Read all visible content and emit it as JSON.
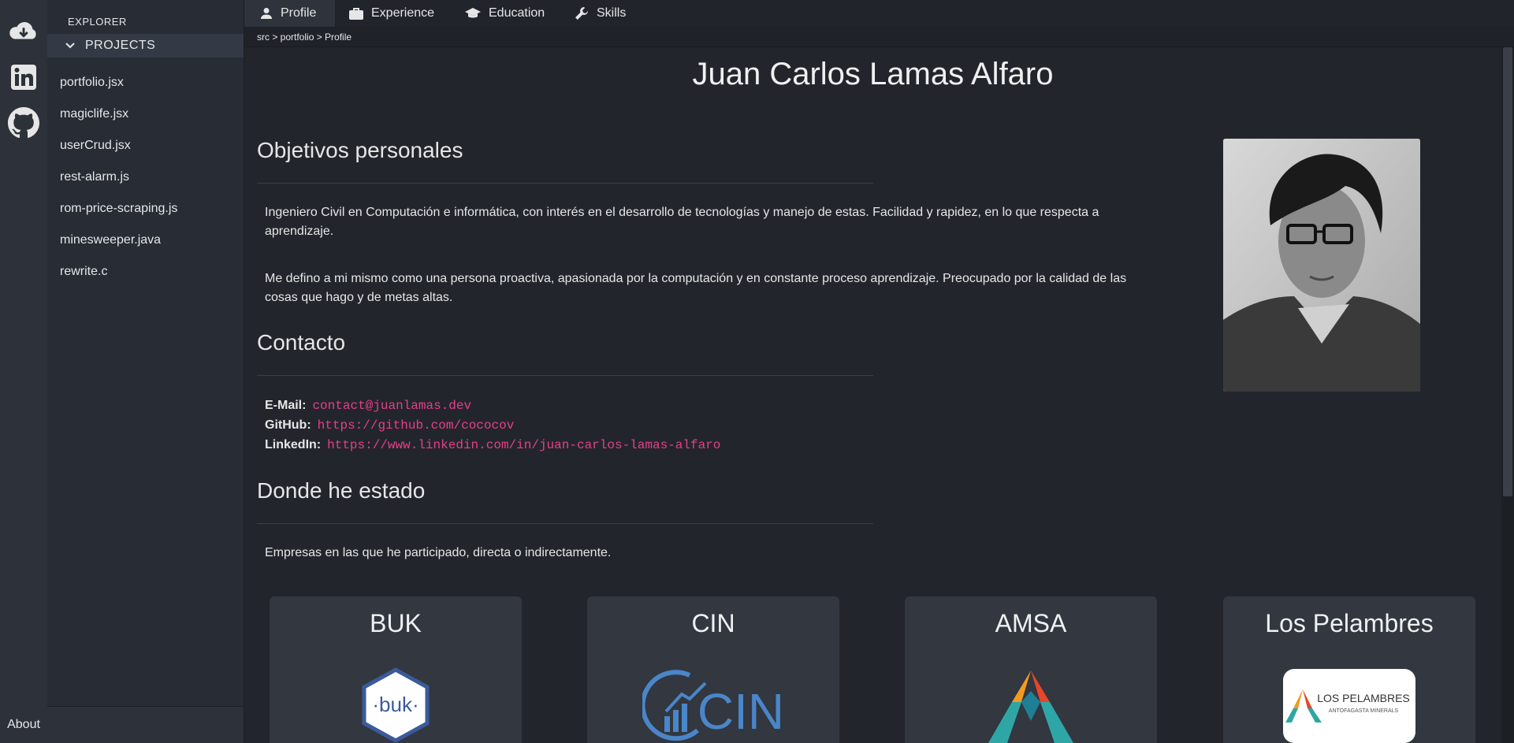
{
  "sidebar": {
    "about_label": "About"
  },
  "explorer": {
    "title": "EXPLORER",
    "section": "PROJECTS",
    "files": [
      "portfolio.jsx",
      "magiclife.jsx",
      "userCrud.jsx",
      "rest-alarm.js",
      "rom-price-scraping.js",
      "minesweeper.java",
      "rewrite.c"
    ]
  },
  "tabs": [
    {
      "label": "Profile",
      "icon": "person-icon",
      "active": true
    },
    {
      "label": "Experience",
      "icon": "briefcase-icon",
      "active": false
    },
    {
      "label": "Education",
      "icon": "graduation-cap-icon",
      "active": false
    },
    {
      "label": "Skills",
      "icon": "wrench-icon",
      "active": false
    }
  ],
  "breadcrumb": "src > portfolio > Profile",
  "profile": {
    "name": "Juan Carlos Lamas Alfaro",
    "objectives_title": "Objetivos personales",
    "objectives_p1": "Ingeniero Civil en Computación e informática, con interés en el desarrollo de tecnologías y manejo de estas. Facilidad y rapidez, en lo que respecta a aprendizaje.",
    "objectives_p2": "Me defino a mi mismo como una persona proactiva, apasionada por la computación y en constante proceso aprendizaje. Preocupado por la calidad de las cosas que hago y de metas altas.",
    "contact_title": "Contacto",
    "contact": {
      "email_label": "E-Mail:",
      "email": "contact@juanlamas.dev",
      "github_label": "GitHub:",
      "github": "https://github.com/cococov",
      "linkedin_label": "LinkedIn:",
      "linkedin": "https://www.linkedin.com/in/juan-carlos-lamas-alfaro"
    },
    "where_title": "Donde he estado",
    "where_desc": "Empresas en las que he participado, directa o indirectamente.",
    "companies": [
      {
        "name": "BUK",
        "logo_text": "·buk·"
      },
      {
        "name": "CIN",
        "logo_text": "CIN"
      },
      {
        "name": "AMSA",
        "logo_text": ""
      },
      {
        "name": "Los Pelambres",
        "logo_text": "LOS PELAMBRES",
        "logo_sub": "ANTOFAGASTA MINERALS"
      }
    ]
  },
  "colors": {
    "background": "#22262c",
    "link": "#e83e8c",
    "sidebar": "#282c34"
  }
}
